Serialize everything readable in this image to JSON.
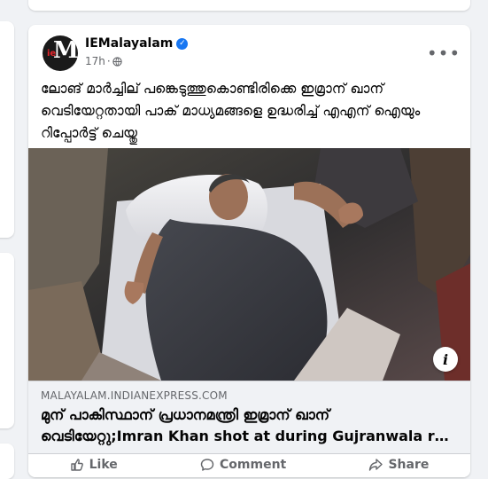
{
  "post": {
    "page_name": "IEMalayalam",
    "verified_icon": "check-icon",
    "timestamp": "17h",
    "separator": "·",
    "privacy_icon": "globe-icon",
    "more_icon": "•••",
    "avatar_letters": {
      "ie": "ie",
      "m": "M"
    },
    "text": "ലോങ് മാർച്ചില് പങ്കെടുത്തുകൊണ്ടിരിക്കെ ഇമ്രാന് ഖാന് വെടിയേറ്റതായി പാക് മാധ്യമങ്ങളെ ഉദ്ധരിച്ച് എഎന് ഐയും റിപ്പോർട്ട് ചെയ്തു",
    "info_icon": "i"
  },
  "link_preview": {
    "domain": "MALAYALAM.INDIANEXPRESS.COM",
    "title_line1": "മുന് പാകിസ്ഥാന് പ്രധാനമന്ത്രി ഇമ്രാന് ഖാന്",
    "title_line2": "വെടിയേറ്റു;Imran Khan shot at during Gujranwala rall..."
  },
  "actions": [
    {
      "icon": "like-icon",
      "label": "Like"
    },
    {
      "icon": "comment-icon",
      "label": "Comment"
    },
    {
      "icon": "share-icon",
      "label": "Share"
    }
  ],
  "colors": {
    "verified": "#1877f2",
    "text": "#050505",
    "secondary": "#65676b",
    "background": "#f0f2f5"
  }
}
